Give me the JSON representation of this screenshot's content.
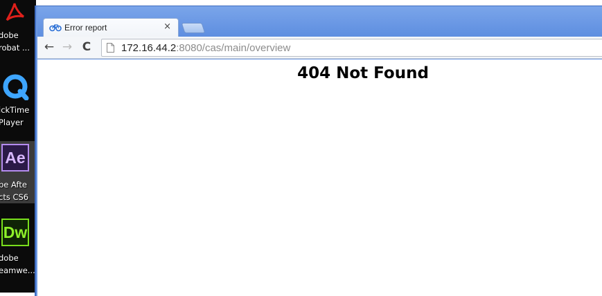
{
  "desktop": {
    "icons": [
      {
        "name": "acrobat",
        "label_lines": [
          "dobe",
          "robat ..."
        ]
      },
      {
        "name": "quicktime",
        "label_lines": [
          "ickTime",
          "Player"
        ]
      },
      {
        "name": "after-effects",
        "tile_text": "Ae",
        "label_lines": [
          "be Afte",
          "cts CS6"
        ]
      },
      {
        "name": "dreamweaver",
        "tile_text": "Dw",
        "label_lines": [
          "dobe",
          "eamwe..."
        ]
      }
    ]
  },
  "browser": {
    "tab": {
      "title": "Error report",
      "close_glyph": "×"
    },
    "toolbar": {
      "back_glyph": "←",
      "forward_glyph": "→",
      "reload_glyph": "C",
      "url_host": "172.16.44.2",
      "url_rest": ":8080/cas/main/overview"
    }
  },
  "page": {
    "heading": "404 Not Found"
  },
  "colors": {
    "titlebar": "#6f9be3",
    "desktop_bg": "#0b0b0b",
    "ae_border": "#b58cf0",
    "dw_border": "#79e01c"
  }
}
